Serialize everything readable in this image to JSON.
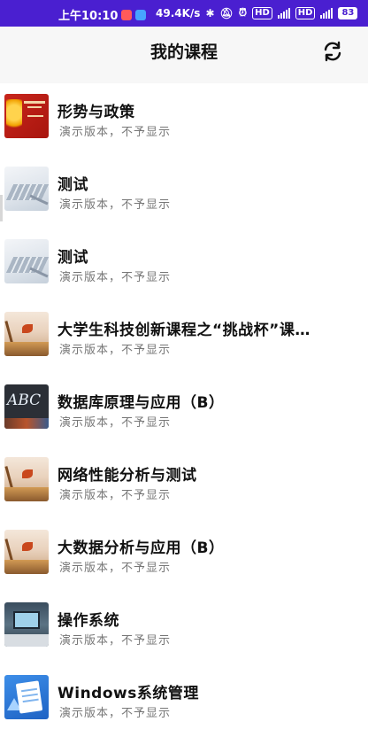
{
  "status_bar": {
    "time": "上午10:10",
    "net_speed": "49.4K/s",
    "battery": "83",
    "signal_label_1": "4G",
    "signal_label_2": "4G",
    "hd_1": "HD",
    "hd_2": "HD"
  },
  "header": {
    "title": "我的课程",
    "refresh_icon": "refresh-icon"
  },
  "courses": [
    {
      "name": "形势与政策",
      "subtitle": "演示版本，不予显示",
      "thumb": "red-banner"
    },
    {
      "name": "测试",
      "subtitle": "演示版本，不予显示",
      "thumb": "keyboard"
    },
    {
      "name": "测试",
      "subtitle": "演示版本，不予显示",
      "thumb": "keyboard"
    },
    {
      "name": "大学生科技创新课程之“挑战杯”课…",
      "subtitle": "演示版本，不予显示",
      "thumb": "autumn"
    },
    {
      "name": "数据库原理与应用（B）",
      "subtitle": "演示版本，不予显示",
      "thumb": "abc-board",
      "thumb_text": "ABC"
    },
    {
      "name": "网络性能分析与测试",
      "subtitle": "演示版本，不予显示",
      "thumb": "autumn"
    },
    {
      "name": "大数据分析与应用（B）",
      "subtitle": "演示版本，不予显示",
      "thumb": "autumn"
    },
    {
      "name": "操作系统",
      "subtitle": "演示版本，不予显示",
      "thumb": "desk"
    },
    {
      "name": "Windows系统管理",
      "subtitle": "演示版本，不予显示",
      "thumb": "notebook-blue"
    }
  ],
  "colors": {
    "status_bar_bg": "#4a1fd0",
    "app_bar_bg": "#f7f7f7",
    "title_text": "#111111",
    "subtitle_text": "#777777"
  }
}
